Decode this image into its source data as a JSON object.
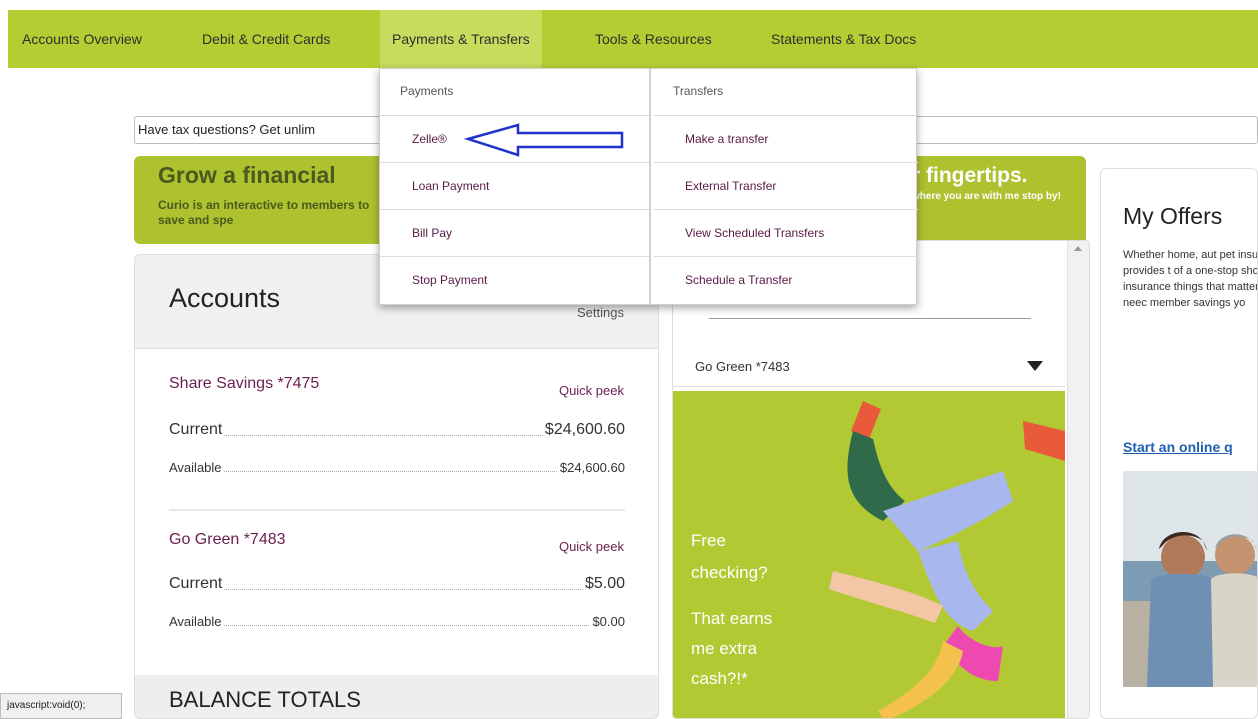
{
  "nav": {
    "items": [
      {
        "label": "Accounts Overview"
      },
      {
        "label": "Debit & Credit Cards"
      },
      {
        "label": "Payments & Transfers"
      },
      {
        "label": "Tools & Resources"
      },
      {
        "label": "Statements & Tax Docs"
      }
    ]
  },
  "tax_bar": {
    "text": "Have tax questions? Get unlim"
  },
  "promo": {
    "title": "Grow a financial",
    "subtitle": "Curio is an interactive to members to save and spe",
    "right_title": "r fingertips.",
    "right_subtitle": "where you are with me stop by!"
  },
  "dropdown": {
    "payments": {
      "heading": "Payments",
      "items": [
        "Zelle®",
        "Loan Payment",
        "Bill Pay",
        "Stop Payment"
      ]
    },
    "transfers": {
      "heading": "Transfers",
      "items": [
        "Make a transfer",
        "External Transfer",
        "View Scheduled Transfers",
        "Schedule a Transfer"
      ]
    }
  },
  "accounts": {
    "title": "Accounts",
    "settings": "Settings",
    "list": [
      {
        "name": "Share Savings *7475",
        "quick_peek": "Quick peek",
        "current_label": "Current",
        "current_value": "$24,600.60",
        "available_label": "Available",
        "available_value": "$24,600.60"
      },
      {
        "name": "Go Green *7483",
        "quick_peek": "Quick peek",
        "current_label": "Current",
        "current_value": "$5.00",
        "available_label": "Available",
        "available_value": "$0.00"
      }
    ],
    "balance_totals": "BALANCE TOTALS"
  },
  "middle": {
    "selected_account": "Go Green *7483",
    "ad_lines": [
      "Free",
      "checking?",
      "That earns",
      "me extra",
      "cash?!*"
    ]
  },
  "offers": {
    "title": "My Offers",
    "text": "Whether home, aut pet insurance, Jovi Services provides t of a one-stop shop members insurance things that matter n protection you neec member savings yo",
    "link": "Start an online q"
  },
  "status_bar": {
    "text": "javascript:void(0);"
  },
  "colors": {
    "nav_green": "#b5cd33",
    "promo_green": "#aec12f",
    "link_purple": "#6a1f4e",
    "arrow_blue": "#2233cc"
  }
}
